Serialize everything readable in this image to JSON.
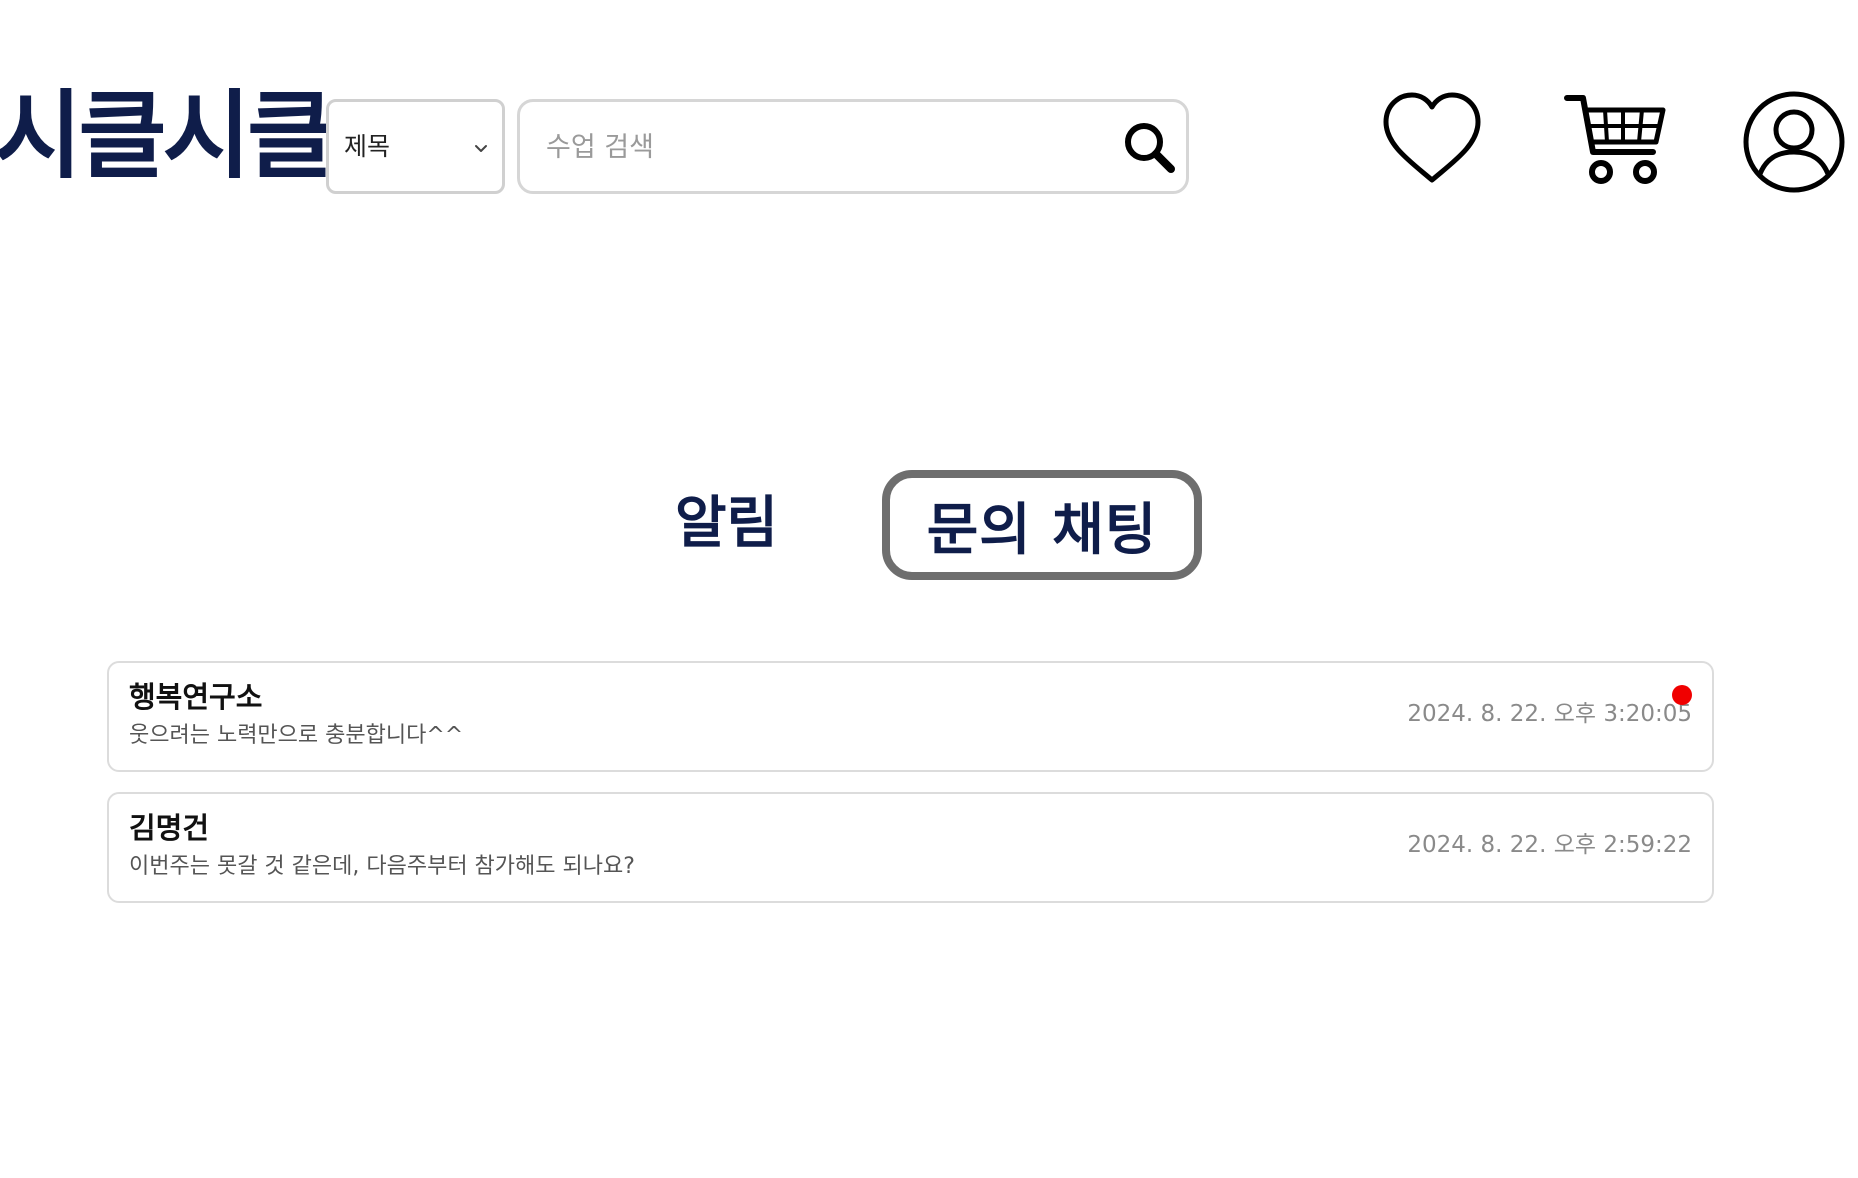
{
  "header": {
    "logo_text": "시클시클",
    "search_type": {
      "selected": "제목",
      "options": [
        "제목"
      ]
    },
    "search": {
      "placeholder": "수업 검색",
      "value": ""
    },
    "icons": [
      "heart-icon",
      "cart-icon",
      "user-icon"
    ]
  },
  "tabs": [
    {
      "label": "알림",
      "active": false
    },
    {
      "label": "문의 채팅",
      "active": true
    }
  ],
  "chats": [
    {
      "name": "행복연구소",
      "message": "웃으려는 노력만으로 충분합니다^^",
      "time": "2024. 8. 22. 오후 3:20:05",
      "unread": true
    },
    {
      "name": "김명건",
      "message": "이번주는 못갈 것 같은데, 다음주부터 참가해도 되나요?",
      "time": "2024. 8. 22. 오후 2:59:22",
      "unread": false
    }
  ],
  "colors": {
    "brand_navy": "#0f1d4a",
    "active_tab_border": "#6e6e6e",
    "unread_dot": "#f00000",
    "muted_text": "#8a8a8a"
  }
}
